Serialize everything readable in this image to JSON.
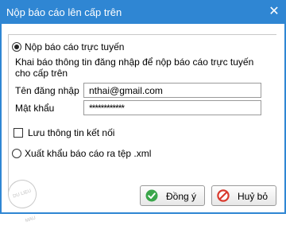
{
  "window": {
    "title": "Nộp báo cáo lên cấp trên",
    "close_glyph": "✕"
  },
  "online": {
    "option_label": "Nộp báo cáo trực tuyến",
    "checked": true,
    "description_line1": "Khai báo thông tin đăng nhập để nộp báo cáo trực tuyến",
    "description_line2": "cho cấp trên",
    "username_label": "Tên đăng nhập",
    "username_value": "nthai@gmail.com",
    "password_label": "Mật khẩu",
    "password_value": "************",
    "remember_label": "Lưu thông tin kết nối",
    "remember_checked": false
  },
  "export": {
    "option_label": "Xuất khẩu báo cáo ra tệp .xml",
    "checked": false
  },
  "buttons": {
    "ok_label": "Đồng ý",
    "ok_icon": "check-circle-icon",
    "cancel_label": "Huỷ bỏ",
    "cancel_icon": "no-entry-icon"
  },
  "colors": {
    "titlebar": "#2f86d3",
    "ok_icon": "#3aa64a",
    "cancel_icon": "#d93a2e"
  }
}
